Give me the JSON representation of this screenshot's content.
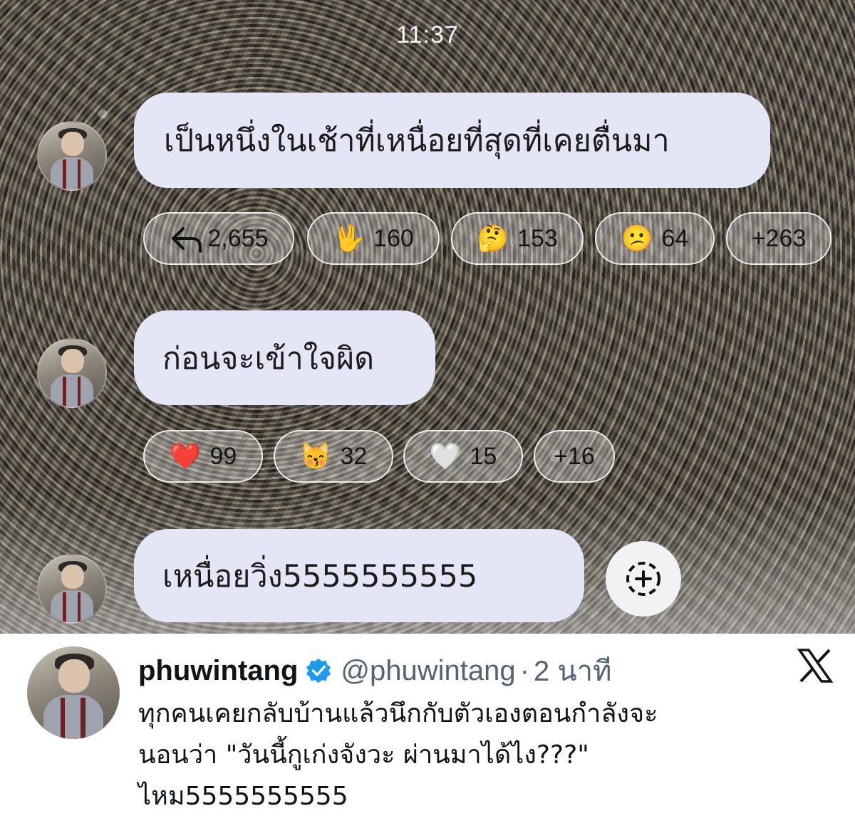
{
  "status_bar": {
    "time": "11:37"
  },
  "messages": [
    {
      "text": "เป็นหนึ่งในเช้าที่เหนื่อยที่สุดที่เคยตื่นมา",
      "reactions": [
        {
          "icon": "reply-arrow-icon",
          "count": "2,655"
        },
        {
          "emoji": "🖖",
          "count": "160"
        },
        {
          "emoji": "🤔",
          "count": "153"
        },
        {
          "emoji": "😕",
          "count": "64"
        },
        {
          "count": "+263"
        }
      ]
    },
    {
      "text": "ก่อนจะเข้าใจผิด",
      "reactions": [
        {
          "emoji": "❤️",
          "count": "99"
        },
        {
          "emoji": "😽",
          "count": "32"
        },
        {
          "emoji": "🤍",
          "count": "15"
        },
        {
          "count": "+16"
        }
      ]
    },
    {
      "text": "เหนื่อยวิ่ง5555555555"
    }
  ],
  "add_reaction_icon": "add-reaction-icon",
  "tweet": {
    "display_name": "phuwintang",
    "handle": "@phuwintang",
    "separator": "·",
    "time": "2 นาที",
    "lines": [
      "ทุกคนเคยกลับบ้านแล้วนึกกับตัวเองตอนกำลังจะ",
      "นอนว่า \"วันนี้กูเก่งจังวะ ผ่านมาได้ไง???\"",
      "ไหม5555555555"
    ],
    "colors": {
      "verified": "#1d9bf0",
      "text": "#0f1419",
      "secondary": "#536471"
    }
  }
}
